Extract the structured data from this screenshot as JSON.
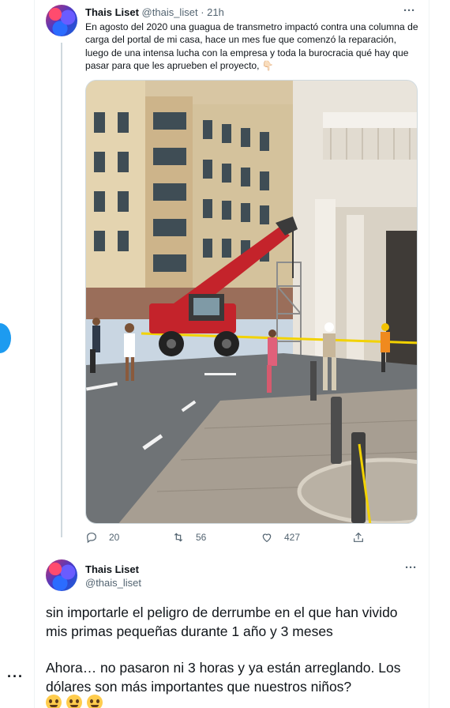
{
  "tweet1": {
    "author_name": "Thais Liset",
    "author_handle": "@thais_liset",
    "separator": "·",
    "time": "21h",
    "text": "En agosto del 2020 una guagua de transmetro impactó contra una columna de carga del portal de mi casa, hace un mes fue que comenzó la reparación, luego de una intensa lucha con la empresa y toda la burocracia qué hay que pasar para que les aprueben el proyecto, 👇🏻",
    "media_icon": "street-photo-crane",
    "replies": "20",
    "retweets": "56",
    "likes": "427"
  },
  "tweet2": {
    "author_name": "Thais Liset",
    "author_handle": "@thais_liset",
    "paragraph1": "sin importarle el peligro de derrumbe en el que han vivido mis primas pequeñas durante 1 año y 3 meses",
    "paragraph2": "Ahora… no pasaron ni 3 horas y ya están arreglando. Los dólares son más importantes que nuestros niños?",
    "emoji_icon": "grimacing-face-icon"
  },
  "colors": {
    "accent": "#1d9bf0",
    "text_primary": "#0f1419",
    "text_secondary": "#536471",
    "border": "#eff3f4"
  }
}
